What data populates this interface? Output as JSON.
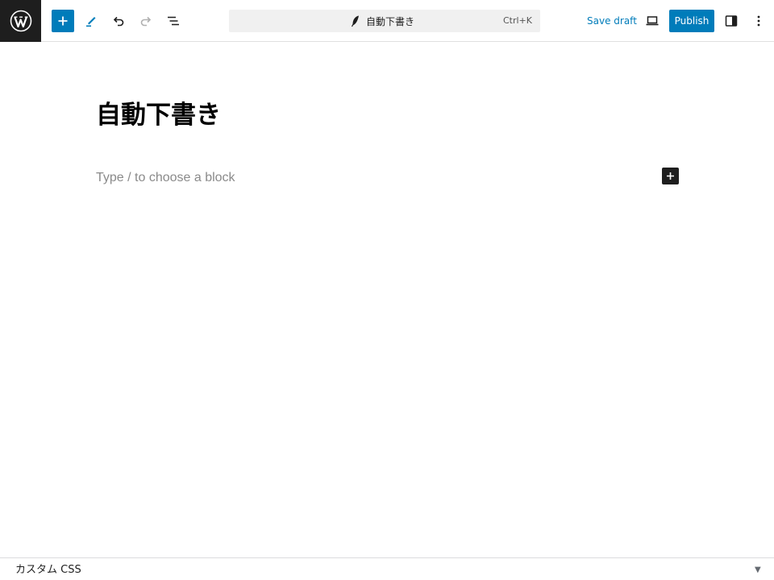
{
  "toolbar": {
    "logo_icon": "wordpress-icon",
    "inserter_icon": "plus-icon",
    "tools_icon": "pen-icon",
    "undo_icon": "undo-icon",
    "redo_icon": "redo-icon",
    "outline_icon": "list-view-icon",
    "save_draft_label": "Save draft",
    "preview_icon": "laptop-icon",
    "publish_label": "Publish",
    "settings_icon": "sidebar-icon",
    "options_icon": "more-vertical-icon",
    "accent_color": "#007cba"
  },
  "command_bar": {
    "icon": "feather-icon",
    "title": "自動下書き",
    "shortcut": "Ctrl+K"
  },
  "editor": {
    "post_title": "自動下書き",
    "block_placeholder": "Type / to choose a block",
    "add_block_icon": "plus-icon"
  },
  "footer": {
    "panel_label": "カスタム CSS",
    "toggle_icon": "triangle-down-icon",
    "toggle_glyph": "▼"
  }
}
